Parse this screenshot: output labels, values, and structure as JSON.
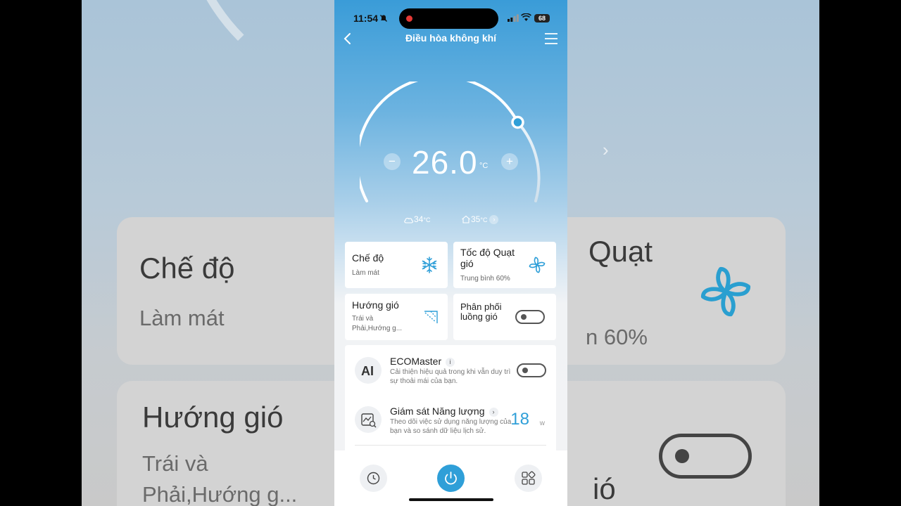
{
  "status_bar": {
    "time": "11:54",
    "battery": "68"
  },
  "header": {
    "title": "Điều hòa không khí"
  },
  "thermostat": {
    "temperature": "26.0",
    "unit": "°C",
    "minus_label": "−",
    "plus_label": "+"
  },
  "environment": {
    "outdoor_temp": "34",
    "indoor_temp": "35",
    "unit": "°C",
    "chevron": "›"
  },
  "cards": {
    "mode": {
      "label": "Chế độ",
      "value": "Làm mát"
    },
    "fan_speed": {
      "label": "Tốc độ Quạt gió",
      "value": "Trung bình 60%"
    },
    "airflow_direction": {
      "label": "Hướng gió",
      "value": "Trái và Phải,Hướng g..."
    },
    "airflow_distribution": {
      "label": "Phân phối luồng gió"
    }
  },
  "eco": {
    "title": "ECOMaster",
    "info": "i",
    "description": "Cải thiện hiệu quả trong khi vẫn duy trì sự thoải mái của bạn."
  },
  "energy": {
    "title": "Giám sát Năng lượng",
    "chevron": "›",
    "description": "Theo dõi việc sử dụng năng lượng của bạn và so sánh dữ liệu lịch sử.",
    "value": "18",
    "unit": "w"
  },
  "background_copy": {
    "mode_label": "Chế độ",
    "mode_value": "Làm mát",
    "fan_label_fragment": "Quạt",
    "fan_value_fragment": "n 60%",
    "dir_label": "Hướng gió",
    "dir_value_line1": "Trái và",
    "dir_value_line2": "Phải,Hướng g...",
    "dist_fragment": "ió"
  },
  "colors": {
    "accent": "#2f9fd8",
    "sky_top": "#3a9cd8",
    "card_bg": "#ffffff"
  }
}
